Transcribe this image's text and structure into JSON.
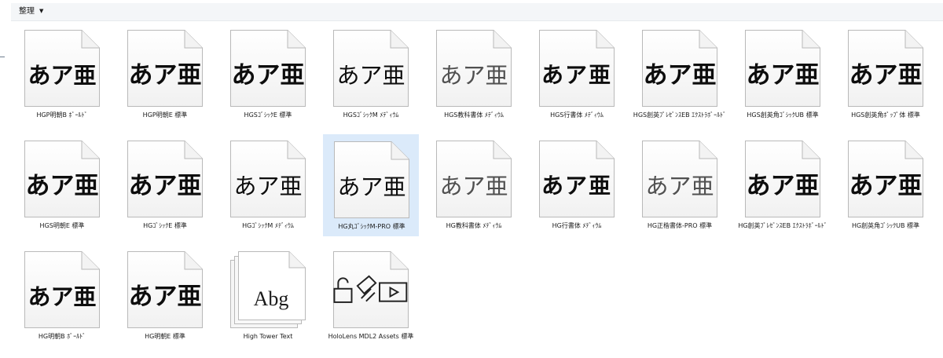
{
  "toolbar": {
    "organize_label": "整理",
    "organize_caret": "▼"
  },
  "colors": {
    "selection": "#dbeafa",
    "toolbar_bg": "#f4f6f8",
    "page_bg": "#ffffff"
  },
  "fonts": [
    {
      "label": "HGP明朝B ﾎﾞｰﾙﾄﾞ",
      "sample": "あア亜",
      "style": "mincho bold"
    },
    {
      "label": "HGP明朝E 標準",
      "sample": "あア亜",
      "style": "mincho heavy"
    },
    {
      "label": "HGSｺﾞｼｯｸE 標準",
      "sample": "あア亜",
      "style": "gothic heavy"
    },
    {
      "label": "HGSｺﾞｼｯｸM ﾒﾃﾞｨｳﾑ",
      "sample": "あア亜",
      "style": "gothic"
    },
    {
      "label": "HGS教科書体 ﾒﾃﾞｨｳﾑ",
      "sample": "あア亜",
      "style": "mincho light"
    },
    {
      "label": "HGS行書体 ﾒﾃﾞｨｳﾑ",
      "sample": "あア亜",
      "style": "brush"
    },
    {
      "label": "HGS創英ﾌﾟﾚｾﾞﾝｽEB ｴｸｽﾄﾗﾎﾞｰﾙﾄﾞ",
      "sample": "あア亜",
      "style": "mincho heavy"
    },
    {
      "label": "HGS創英角ｺﾞｼｯｸUB 標準",
      "sample": "あア亜",
      "style": "gothic heavy"
    },
    {
      "label": "HGS創英角ﾎﾟｯﾌﾟ体 標準",
      "sample": "あア亜",
      "style": "gothic heavy"
    },
    {
      "label": "HGS明朝E 標準",
      "sample": "あア亜",
      "style": "mincho heavy"
    },
    {
      "label": "HGｺﾞｼｯｸE 標準",
      "sample": "あア亜",
      "style": "gothic heavy"
    },
    {
      "label": "HGｺﾞｼｯｸM ﾒﾃﾞｨｳﾑ",
      "sample": "あア亜",
      "style": "gothic"
    },
    {
      "label": "HG丸ｺﾞｼｯｸM-PRO 標準",
      "sample": "あア亜",
      "style": "gothic",
      "selected": true
    },
    {
      "label": "HG教科書体 ﾒﾃﾞｨｳﾑ",
      "sample": "あア亜",
      "style": "mincho light"
    },
    {
      "label": "HG行書体 ﾒﾃﾞｨｳﾑ",
      "sample": "あア亜",
      "style": "brush"
    },
    {
      "label": "HG正楷書体-PRO 標準",
      "sample": "あア亜",
      "style": "mincho light"
    },
    {
      "label": "HG創英ﾌﾟﾚｾﾞﾝｽEB ｴｸｽﾄﾗﾎﾞｰﾙﾄﾞ",
      "sample": "あア亜",
      "style": "mincho heavy"
    },
    {
      "label": "HG創英角ｺﾞｼｯｸUB 標準",
      "sample": "あア亜",
      "style": "gothic heavy"
    },
    {
      "label": "HG明朝B ﾎﾞｰﾙﾄﾞ",
      "sample": "あア亜",
      "style": "mincho bold"
    },
    {
      "label": "HG明朝E 標準",
      "sample": "あア亜",
      "style": "mincho heavy"
    },
    {
      "label": "High Tower Text",
      "sample": "Abg",
      "style": "latin",
      "stacked": true
    },
    {
      "label": "HoloLens MDL2 Assets 標準",
      "sample": "",
      "style": "icons",
      "icon": "lock-ink-video-icons"
    }
  ]
}
